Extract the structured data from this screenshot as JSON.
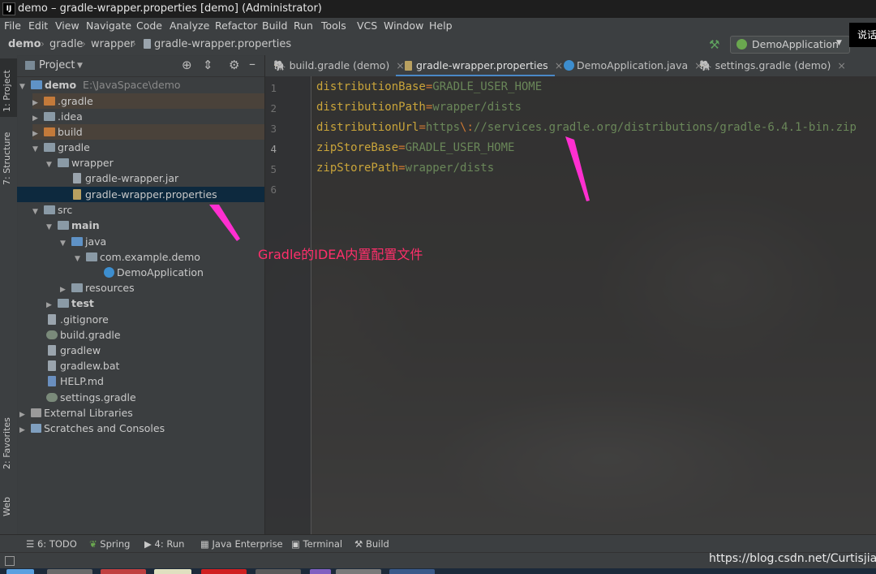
{
  "window": {
    "title": "demo – gradle-wrapper.properties [demo] (Administrator)",
    "app_badge": "IJ"
  },
  "menu": [
    "File",
    "Edit",
    "View",
    "Navigate",
    "Code",
    "Analyze",
    "Refactor",
    "Build",
    "Run",
    "Tools",
    "VCS",
    "Window",
    "Help"
  ],
  "breadcrumb": [
    "demo",
    "gradle",
    "wrapper",
    "gradle-wrapper.properties"
  ],
  "run_config": {
    "label": "DemoApplication"
  },
  "overlay_popup": "说话",
  "left_stripe": [
    "1: Project",
    "7: Structure",
    "2: Favorites",
    "Web"
  ],
  "project_panel": {
    "title": "Project",
    "tree": [
      {
        "label": "demo",
        "extra": "E:\\JavaSpace\\demo",
        "bold": true
      },
      {
        "label": ".gradle"
      },
      {
        "label": ".idea"
      },
      {
        "label": "build"
      },
      {
        "label": "gradle"
      },
      {
        "label": "wrapper"
      },
      {
        "label": "gradle-wrapper.jar"
      },
      {
        "label": "gradle-wrapper.properties"
      },
      {
        "label": "src"
      },
      {
        "label": "main",
        "bold": true
      },
      {
        "label": "java"
      },
      {
        "label": "com.example.demo"
      },
      {
        "label": "DemoApplication"
      },
      {
        "label": "resources"
      },
      {
        "label": "test",
        "bold": true
      },
      {
        "label": ".gitignore"
      },
      {
        "label": "build.gradle"
      },
      {
        "label": "gradlew"
      },
      {
        "label": "gradlew.bat"
      },
      {
        "label": "HELP.md"
      },
      {
        "label": "settings.gradle"
      },
      {
        "label": "External Libraries"
      },
      {
        "label": "Scratches and Consoles"
      }
    ]
  },
  "editor_tabs": [
    "build.gradle (demo)",
    "gradle-wrapper.properties",
    "DemoApplication.java",
    "settings.gradle (demo)"
  ],
  "editor": {
    "line_numbers": [
      "1",
      "2",
      "3",
      "4",
      "5",
      "6"
    ],
    "lines": [
      {
        "key": "distributionBase",
        "eq": "=",
        "val": "GRADLE_USER_HOME"
      },
      {
        "key": "distributionPath",
        "eq": "=",
        "val": "wrapper/dists"
      },
      {
        "key": "distributionUrl",
        "eq": "=",
        "val_pre": "https",
        "esc": "\\:",
        "val": "//services.gradle.org/distributions/gradle-6.4.1-bin.zip"
      },
      {
        "key": "zipStoreBase",
        "eq": "=",
        "val": "GRADLE_USER_HOME"
      },
      {
        "key": "zipStorePath",
        "eq": "=",
        "val": "wrapper/dists"
      }
    ]
  },
  "annotation": "Gradle的IDEA内置配置文件",
  "bottom_tabs": [
    "6: TODO",
    "Spring",
    "4: Run",
    "Java Enterprise",
    "Terminal",
    "Build"
  ],
  "watermark": "https://blog.csdn.net/Curtisjia",
  "colors": {
    "key": "#c9a43a",
    "value": "#6a8759",
    "annotation": "#ff2f6b",
    "selection": "#0d293e"
  }
}
